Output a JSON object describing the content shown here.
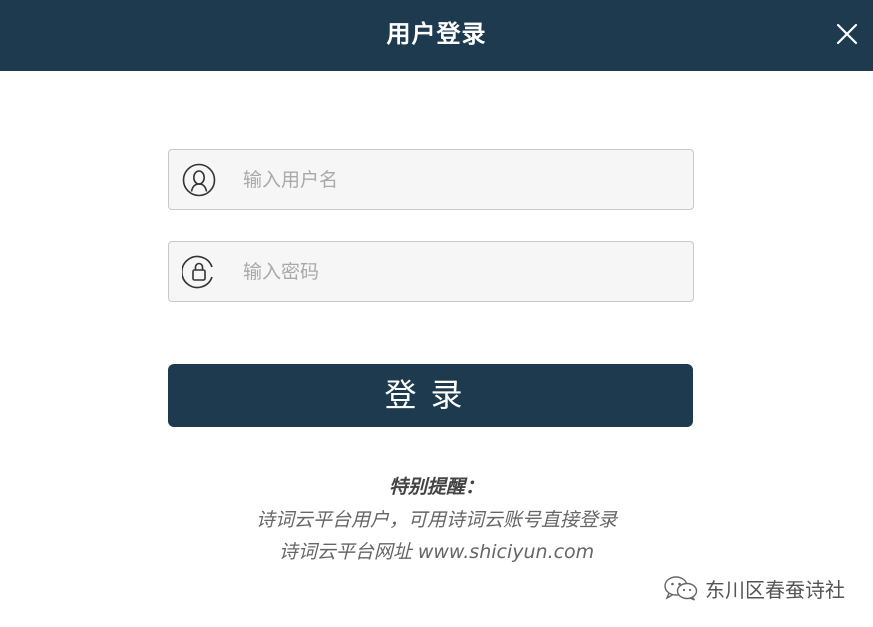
{
  "dialog": {
    "title": "用户登录"
  },
  "username": {
    "placeholder": "输入用户名",
    "value": ""
  },
  "password": {
    "placeholder": "输入密码",
    "value": ""
  },
  "login": {
    "label": "登录"
  },
  "reminder": {
    "title": "特别提醒：",
    "line1": "诗词云平台用户，可用诗词云账号直接登录",
    "line2": "诗词云平台网址 www.shiciyun.com"
  },
  "watermark": {
    "text": "东川区春蚕诗社",
    "icon": "wechat-icon"
  },
  "icons": {
    "close": "close-icon",
    "user": "user-icon",
    "lock": "lock-icon"
  },
  "colors": {
    "header_bg": "#1e3a4f",
    "button_bg": "#1e3a4f",
    "field_bg": "#f6f6f6",
    "field_border": "#c8c8c8"
  }
}
